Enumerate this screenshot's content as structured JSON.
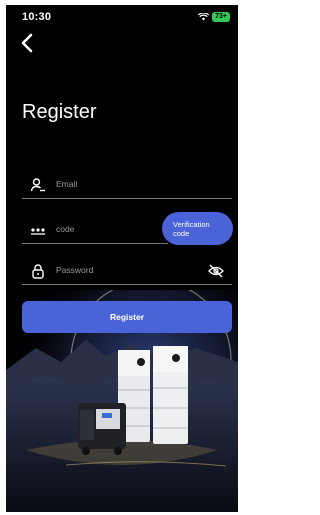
{
  "status_bar": {
    "time": "10:30",
    "battery": "73+"
  },
  "page": {
    "title": "Register"
  },
  "form": {
    "email_placeholder": "Email",
    "code_placeholder": "code",
    "password_placeholder": "Password",
    "verify_line1": "Verification",
    "verify_line2": "code",
    "register_label": "Register"
  },
  "icons": {
    "back": "chevron-left-icon",
    "email": "user-icon",
    "code": "dots-icon",
    "password": "lock-icon",
    "visibility": "eye-off-icon"
  },
  "colors": {
    "accent": "#4a63d6",
    "background": "#000000"
  }
}
